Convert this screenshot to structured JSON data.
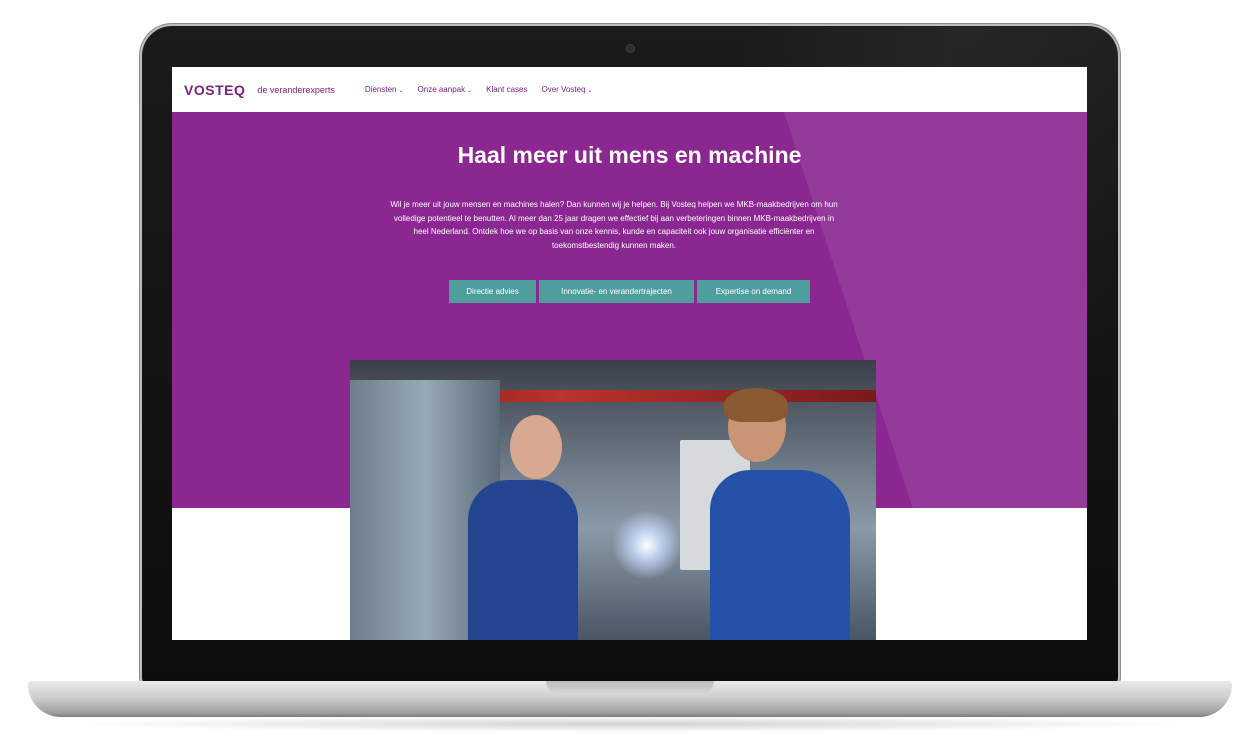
{
  "brand": {
    "logo": "VOSTEQ",
    "tagline": "de veranderexperts",
    "color": "#7c2080"
  },
  "nav": {
    "items": [
      {
        "label": "Diensten",
        "has_dropdown": true
      },
      {
        "label": "Onze aanpak",
        "has_dropdown": true
      },
      {
        "label": "Klant cases",
        "has_dropdown": false
      },
      {
        "label": "Over Vosteq",
        "has_dropdown": true
      }
    ],
    "caret": "⌄"
  },
  "hero": {
    "title": "Haal meer uit mens en machine",
    "text": "Wil je meer uit jouw mensen en machines halen? Dan kunnen wij je helpen. Bij Vosteq helpen we MKB-maakbedrijven om hun volledige potentieel te benutten. Al meer dan 25 jaar dragen we effectief bij aan verbeteringen binnen MKB-maakbedrijven in heel Nederland. Ontdek hoe we op basis van onze kennis, kunde en capaciteit ook jouw organisatie efficiënter en toekomstbestendig kunnen maken.",
    "background_color": "#8a2790",
    "buttons": [
      {
        "label": "Directie advies"
      },
      {
        "label": "Innovatie- en verandertrajecten"
      },
      {
        "label": "Expertise on demand"
      }
    ],
    "button_color": "#4e9e9d",
    "image": "two-men-in-blue-workwear-talking-in-factory"
  }
}
